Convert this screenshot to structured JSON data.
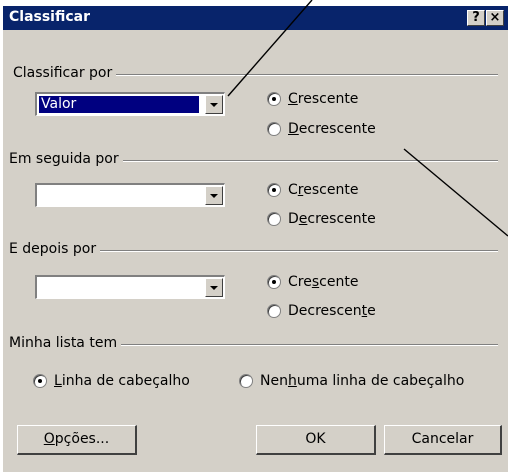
{
  "dialog": {
    "title": "Classificar",
    "help_label": "?",
    "close_label": "×"
  },
  "sort1": {
    "label": "Classificar por",
    "value": "Valor",
    "asc": {
      "pre": "",
      "key": "C",
      "post": "rescente",
      "selected": true
    },
    "desc": {
      "pre": "",
      "key": "D",
      "post": "ecrescente",
      "selected": false
    }
  },
  "sort2": {
    "label": "Em seguida por",
    "value": "",
    "asc": {
      "pre": "C",
      "key": "r",
      "post": "escente",
      "selected": true
    },
    "desc": {
      "pre": "D",
      "key": "e",
      "post": "crescente",
      "selected": false
    }
  },
  "sort3": {
    "label": "E depois por",
    "value": "",
    "asc": {
      "pre": "Cre",
      "key": "s",
      "post": "cente",
      "selected": true
    },
    "desc": {
      "pre": "Decrescen",
      "key": "t",
      "post": "e",
      "selected": false
    }
  },
  "header": {
    "label": "Minha lista tem",
    "with_header": {
      "pre": "",
      "key": "L",
      "post": "inha de cabeçalho",
      "selected": true
    },
    "no_header": {
      "pre": "Nen",
      "key": "h",
      "post": "uma linha de cabeçalho",
      "selected": false
    }
  },
  "buttons": {
    "options": {
      "pre": "",
      "key": "O",
      "post": "pções..."
    },
    "ok": "OK",
    "cancel": "Cancelar"
  }
}
